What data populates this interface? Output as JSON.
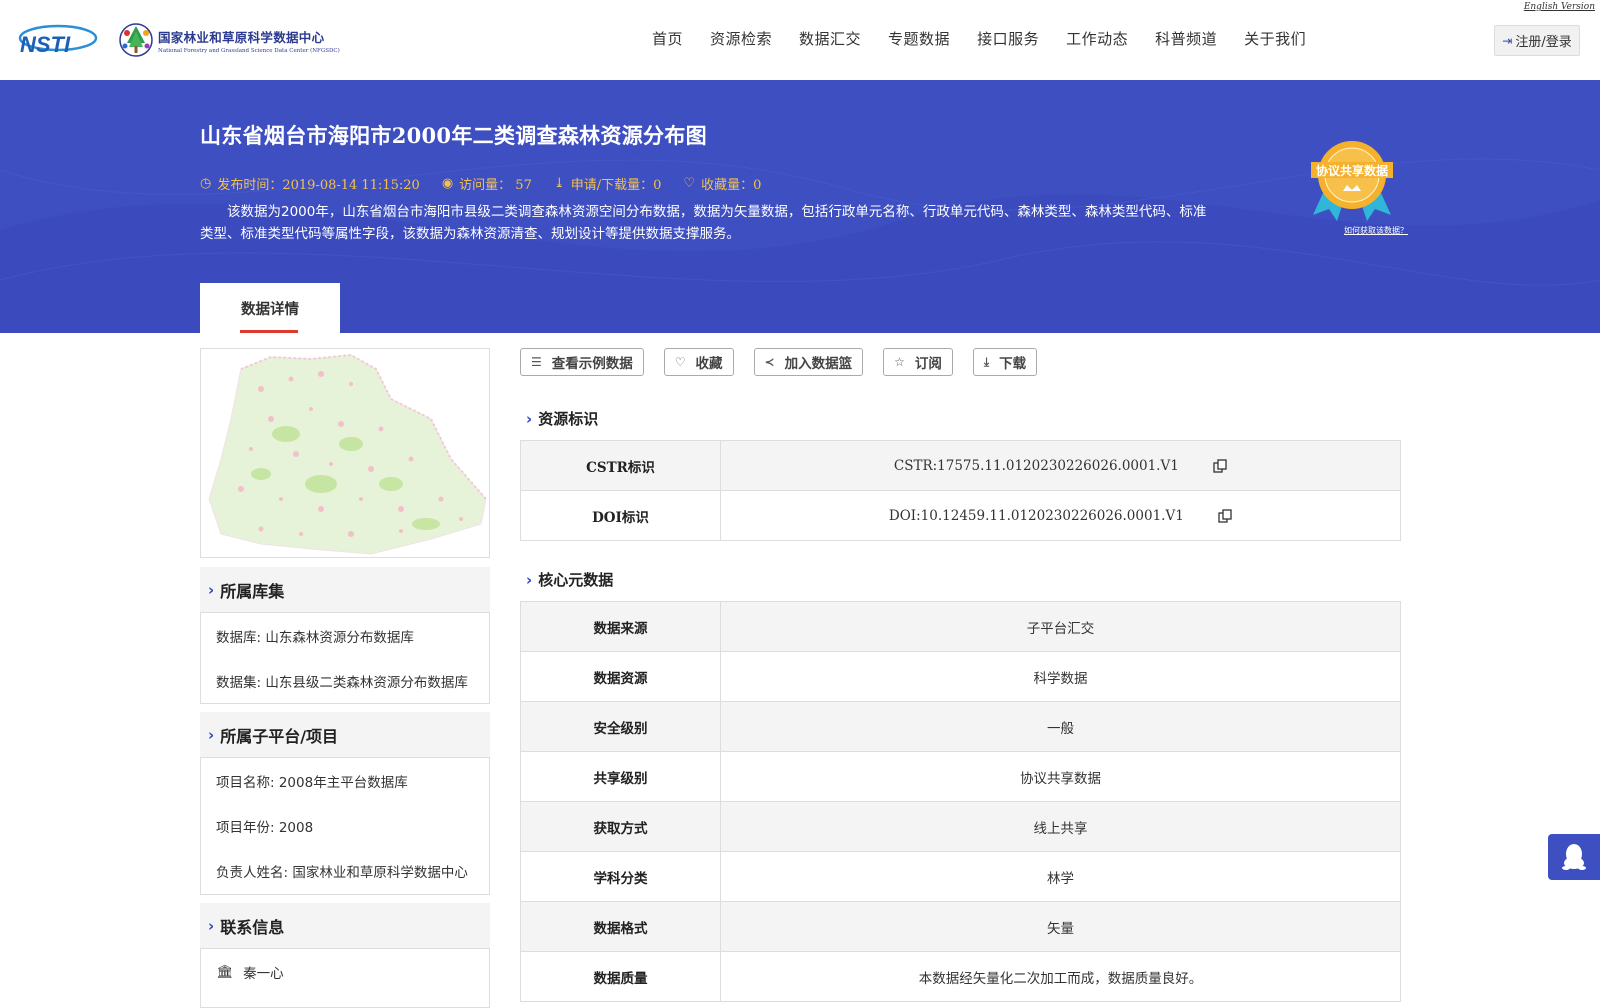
{
  "header": {
    "english_version": "English Version",
    "logo_text": "NSTI",
    "center_name_cn": "国家林业和草原科学数据中心",
    "center_name_en": "National Forestry and Grassland Science Data Center (NFGSDC)",
    "nav": [
      "首页",
      "资源检索",
      "数据汇交",
      "专题数据",
      "接口服务",
      "工作动态",
      "科普频道",
      "关于我们"
    ],
    "login": "注册/登录"
  },
  "banner": {
    "title": "山东省烟台市海阳市2000年二类调查森林资源分布图",
    "publish_time": "发布时间：2019-08-14 11:15:20",
    "visits": "访问量： 57",
    "downloads": "申请/下载量：0",
    "favorites": "收藏量：0",
    "description": "该数据为2000年，山东省烟台市海阳市县级二类调查森林资源空间分布数据，数据为矢量数据，包括行政单元名称、行政单元代码、森林类型、森林类型代码、标准类型、标准类型代码等属性字段，该数据为森林资源清查、规划设计等提供数据支撑服务。",
    "badge_text": "协议共享数据",
    "badge_link": "如何获取该数据？",
    "tab": "数据详情"
  },
  "actions": [
    "查看示例数据",
    "收藏",
    "加入数据篮",
    "订阅",
    "下载"
  ],
  "left": {
    "library_title": "所属库集",
    "database": "数据库: 山东森林资源分布数据库",
    "dataset": "数据集: 山东县级二类森林资源分布数据库",
    "project_title": "所属子平台/项目",
    "project_name": "项目名称: 2008年主平台数据库",
    "project_year": "项目年份: 2008",
    "owner": "负责人姓名: 国家林业和草原科学数据中心",
    "contact_title": "联系信息",
    "contact_name": "秦一心"
  },
  "resource_id": {
    "title": "资源标识",
    "rows": [
      {
        "k": "CSTR标识",
        "v": "CSTR:17575.11.0120230226026.0001.V1"
      },
      {
        "k": "DOI标识",
        "v": "DOI:10.12459.11.0120230226026.0001.V1"
      }
    ]
  },
  "core_meta": {
    "title": "核心元数据",
    "rows": [
      {
        "k": "数据来源",
        "v": "子平台汇交"
      },
      {
        "k": "数据资源",
        "v": "科学数据"
      },
      {
        "k": "安全级别",
        "v": "一般"
      },
      {
        "k": "共享级别",
        "v": "协议共享数据"
      },
      {
        "k": "获取方式",
        "v": "线上共享"
      },
      {
        "k": "学科分类",
        "v": "林学"
      },
      {
        "k": "数据格式",
        "v": "矢量"
      },
      {
        "k": "数据质量",
        "v": "本数据经矢量化二次加工而成，数据质量良好。"
      }
    ]
  }
}
